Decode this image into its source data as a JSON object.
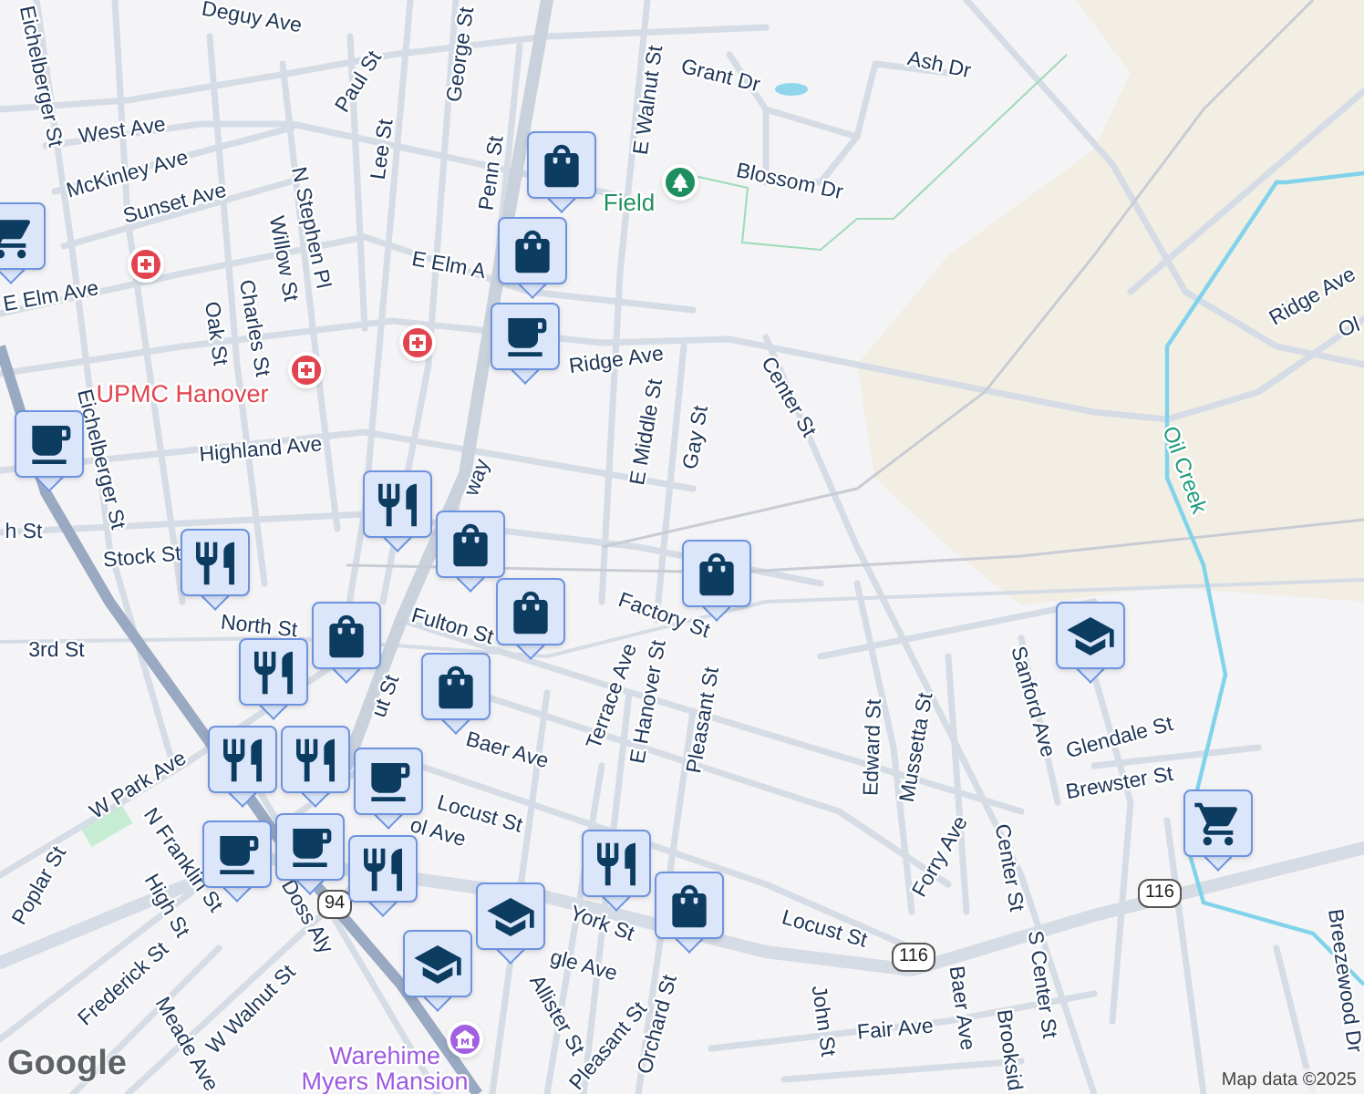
{
  "labels": [
    {
      "text": "Deguy Ave",
      "kind": "street"
    },
    {
      "text": "Eichelberger St",
      "kind": "street"
    },
    {
      "text": "Paul St",
      "kind": "street"
    },
    {
      "text": "George St",
      "kind": "street"
    },
    {
      "text": "Lee St",
      "kind": "street"
    },
    {
      "text": "West Ave",
      "kind": "street"
    },
    {
      "text": "McKinley Ave",
      "kind": "street"
    },
    {
      "text": "Sunset Ave",
      "kind": "street"
    },
    {
      "text": "N Stephen Pl",
      "kind": "street"
    },
    {
      "text": "Willow St",
      "kind": "street"
    },
    {
      "text": "Penn St",
      "kind": "street"
    },
    {
      "text": "E Walnut St",
      "kind": "street"
    },
    {
      "text": "Grant Dr",
      "kind": "street"
    },
    {
      "text": "Ash Dr",
      "kind": "street"
    },
    {
      "text": "Blossom Dr",
      "kind": "street"
    },
    {
      "text": "Field",
      "kind": "park"
    },
    {
      "text": "E Elm A",
      "kind": "street"
    },
    {
      "text": "E Elm Ave",
      "kind": "street"
    },
    {
      "text": "Oak St",
      "kind": "street"
    },
    {
      "text": "Charles St",
      "kind": "street"
    },
    {
      "text": "UPMC Hanover",
      "kind": "hospital"
    },
    {
      "text": "Ridge Ave",
      "kind": "street"
    },
    {
      "text": "E Middle St",
      "kind": "street"
    },
    {
      "text": "Gay St",
      "kind": "street"
    },
    {
      "text": "Center St",
      "kind": "street"
    },
    {
      "text": "Highland Ave",
      "kind": "street"
    },
    {
      "text": "Eichelberger St",
      "kind": "street"
    },
    {
      "text": "Stock St",
      "kind": "street"
    },
    {
      "text": "h St",
      "kind": "street"
    },
    {
      "text": "way",
      "kind": "street"
    },
    {
      "text": "North St",
      "kind": "street"
    },
    {
      "text": "3rd St",
      "kind": "street"
    },
    {
      "text": "Fulton St",
      "kind": "street"
    },
    {
      "text": "Factory St",
      "kind": "street"
    },
    {
      "text": "ut St",
      "kind": "street"
    },
    {
      "text": "Terrace Ave",
      "kind": "street"
    },
    {
      "text": "E Hanover St",
      "kind": "street"
    },
    {
      "text": "Pleasant St",
      "kind": "street"
    },
    {
      "text": "Baer Ave",
      "kind": "street"
    },
    {
      "text": "W Park Ave",
      "kind": "street"
    },
    {
      "text": "Locust St",
      "kind": "street"
    },
    {
      "text": "ol Ave",
      "kind": "street"
    },
    {
      "text": "N Franklin St",
      "kind": "street"
    },
    {
      "text": "Poplar St",
      "kind": "street"
    },
    {
      "text": "High St",
      "kind": "street"
    },
    {
      "text": "Doss Aly",
      "kind": "street"
    },
    {
      "text": "York St",
      "kind": "street"
    },
    {
      "text": "Frederick St",
      "kind": "street"
    },
    {
      "text": "W Walnut St",
      "kind": "street"
    },
    {
      "text": "Allister St",
      "kind": "street"
    },
    {
      "text": "gle Ave",
      "kind": "street"
    },
    {
      "text": "Meade Ave",
      "kind": "street"
    },
    {
      "text": "Pleasant St",
      "kind": "street"
    },
    {
      "text": "Orchard St",
      "kind": "street"
    },
    {
      "text": "Warehime",
      "kind": "museum"
    },
    {
      "text": "Myers Mansion",
      "kind": "museum"
    },
    {
      "text": "Edward St",
      "kind": "street"
    },
    {
      "text": "Mussetta St",
      "kind": "street"
    },
    {
      "text": "Sanford Ave",
      "kind": "street"
    },
    {
      "text": "Glendale St",
      "kind": "street"
    },
    {
      "text": "Brewster St",
      "kind": "street"
    },
    {
      "text": "Forry Ave",
      "kind": "street"
    },
    {
      "text": "Center St",
      "kind": "street"
    },
    {
      "text": "Locust St",
      "kind": "street"
    },
    {
      "text": "John St",
      "kind": "street"
    },
    {
      "text": "Fair Ave",
      "kind": "street"
    },
    {
      "text": "Baer Ave",
      "kind": "street"
    },
    {
      "text": "Brooksid",
      "kind": "street"
    },
    {
      "text": "S Center St",
      "kind": "street"
    },
    {
      "text": "Breezewood Dr",
      "kind": "street"
    },
    {
      "text": "Ridge Ave",
      "kind": "street"
    },
    {
      "text": "Ol",
      "kind": "street"
    },
    {
      "text": "Oil Creek",
      "kind": "water"
    }
  ],
  "route_shields": [
    {
      "text": "94"
    },
    {
      "text": "116"
    },
    {
      "text": "116"
    }
  ],
  "markers": [
    {
      "kind": "park_pin"
    },
    {
      "kind": "hospital_pin"
    },
    {
      "kind": "hospital_pin"
    },
    {
      "kind": "hospital_badge"
    },
    {
      "kind": "museum_pin"
    },
    {
      "kind": "shopping"
    },
    {
      "kind": "shopping"
    },
    {
      "kind": "cafe"
    },
    {
      "kind": "cafe"
    },
    {
      "kind": "grocery"
    },
    {
      "kind": "restaurant"
    },
    {
      "kind": "shopping"
    },
    {
      "kind": "restaurant"
    },
    {
      "kind": "shopping"
    },
    {
      "kind": "shopping"
    },
    {
      "kind": "shopping"
    },
    {
      "kind": "restaurant"
    },
    {
      "kind": "shopping"
    },
    {
      "kind": "restaurant"
    },
    {
      "kind": "restaurant"
    },
    {
      "kind": "cafe"
    },
    {
      "kind": "cafe"
    },
    {
      "kind": "cafe"
    },
    {
      "kind": "restaurant"
    },
    {
      "kind": "restaurant"
    },
    {
      "kind": "shopping"
    },
    {
      "kind": "school"
    },
    {
      "kind": "school"
    },
    {
      "kind": "school"
    },
    {
      "kind": "grocery"
    }
  ],
  "attribution": {
    "logo": "Google",
    "text": "Map data ©2025"
  }
}
